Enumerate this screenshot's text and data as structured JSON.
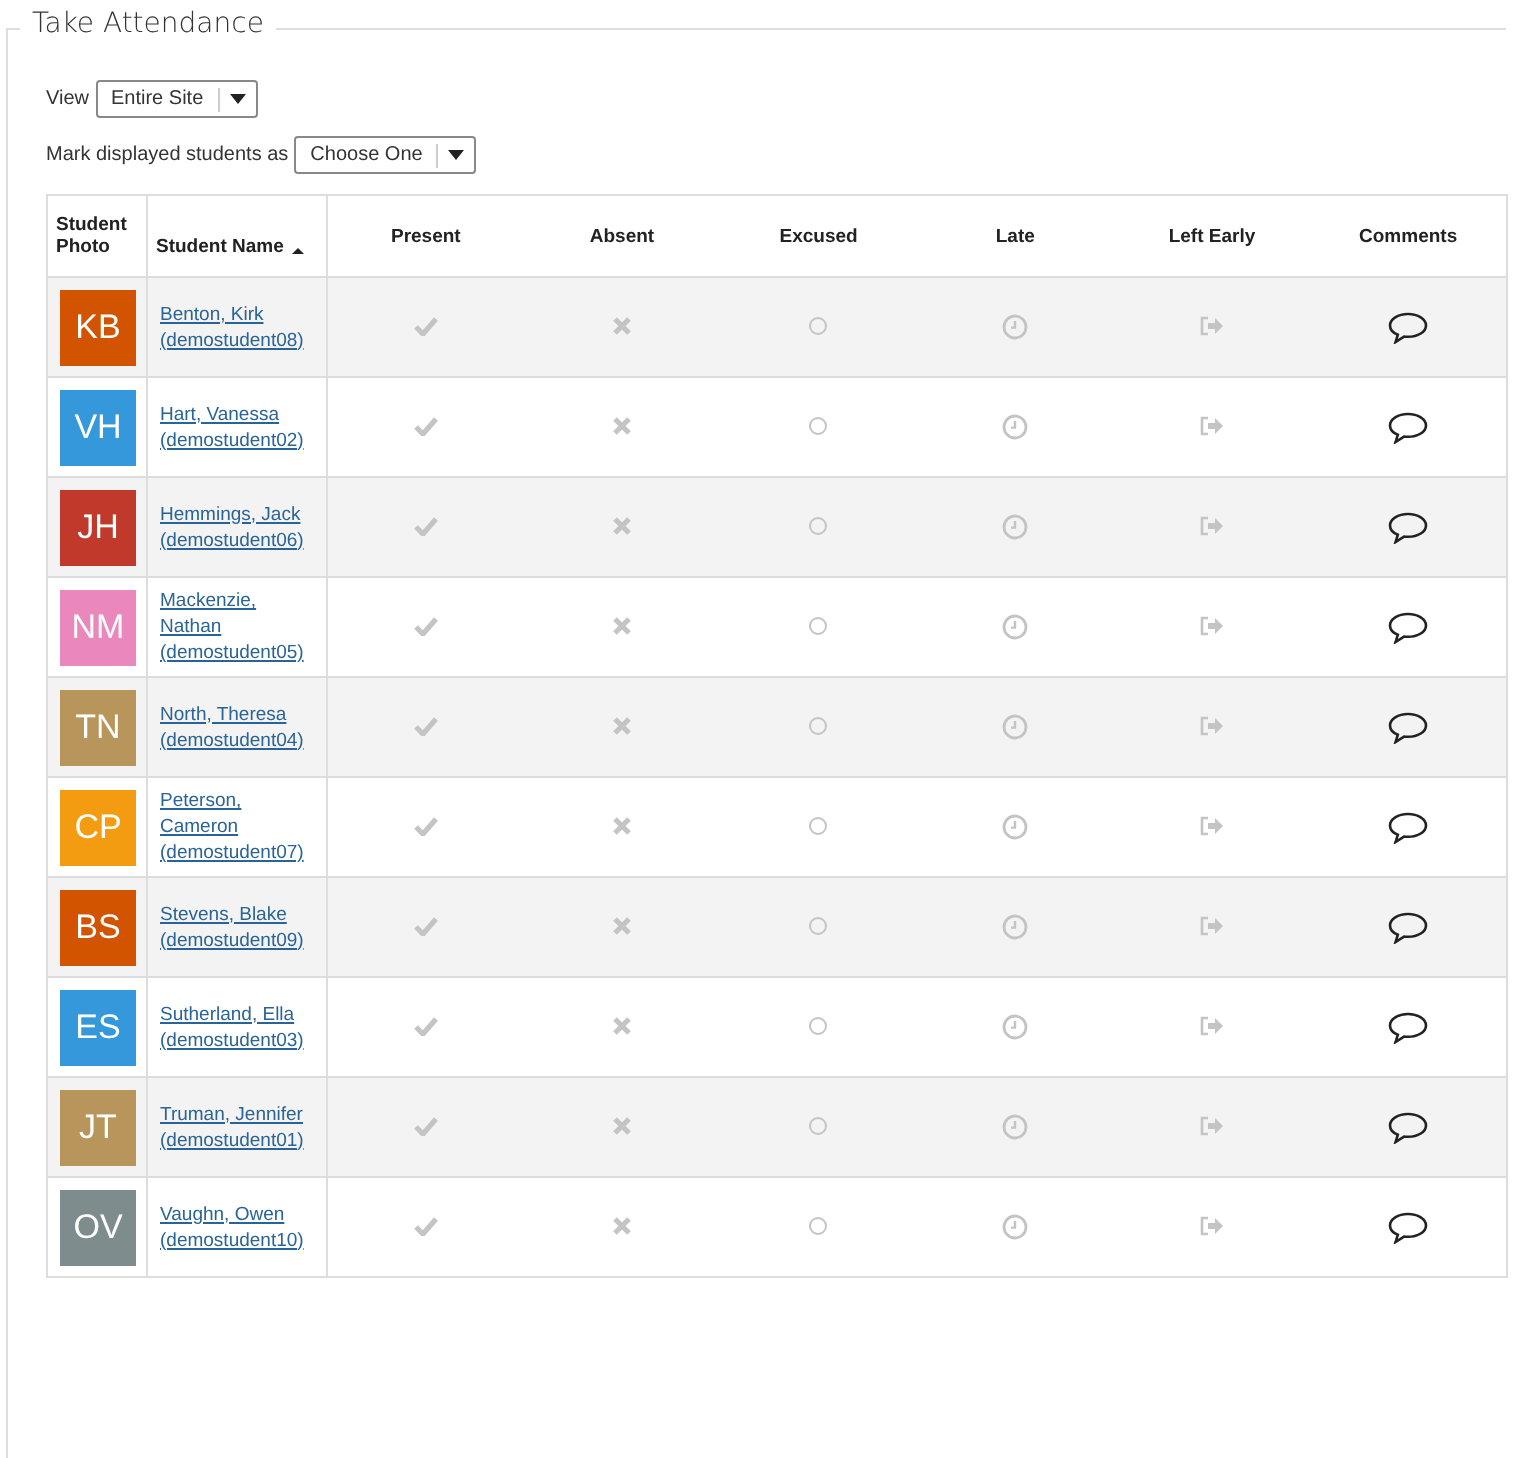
{
  "title": "Take Attendance",
  "view": {
    "label": "View",
    "value": "Entire Site"
  },
  "mark_all": {
    "label": "Mark displayed students as",
    "value": "Choose One"
  },
  "columns": [
    {
      "label": "Student Photo",
      "sorted": false
    },
    {
      "label": "Student Name",
      "sorted": true
    },
    {
      "label": "Present",
      "sorted": false
    },
    {
      "label": "Absent",
      "sorted": false
    },
    {
      "label": "Excused",
      "sorted": false
    },
    {
      "label": "Late",
      "sorted": false
    },
    {
      "label": "Left Early",
      "sorted": false
    },
    {
      "label": "Comments",
      "sorted": false
    }
  ],
  "students": [
    {
      "initials": "KB",
      "color": "#d35400",
      "name": "Benton, Kirk",
      "username": "(demostudent08)"
    },
    {
      "initials": "VH",
      "color": "#3498db",
      "name": "Hart, Vanessa",
      "username": "(demostudent02)"
    },
    {
      "initials": "JH",
      "color": "#c0392b",
      "name": "Hemmings, Jack",
      "username": "(demostudent06)"
    },
    {
      "initials": "NM",
      "color": "#ea88bd",
      "name": "Mackenzie, Nathan",
      "username": "(demostudent05)"
    },
    {
      "initials": "TN",
      "color": "#b8955a",
      "name": "North, Theresa",
      "username": "(demostudent04)"
    },
    {
      "initials": "CP",
      "color": "#f39c12",
      "name": "Peterson, Cameron",
      "username": "(demostudent07)"
    },
    {
      "initials": "BS",
      "color": "#d35400",
      "name": "Stevens, Blake",
      "username": "(demostudent09)"
    },
    {
      "initials": "ES",
      "color": "#3498db",
      "name": "Sutherland, Ella",
      "username": "(demostudent03)"
    },
    {
      "initials": "JT",
      "color": "#b8955a",
      "name": "Truman, Jennifer",
      "username": "(demostudent01)"
    },
    {
      "initials": "OV",
      "color": "#7f8c8d",
      "name": "Vaughn, Owen",
      "username": "(demostudent10)"
    }
  ]
}
